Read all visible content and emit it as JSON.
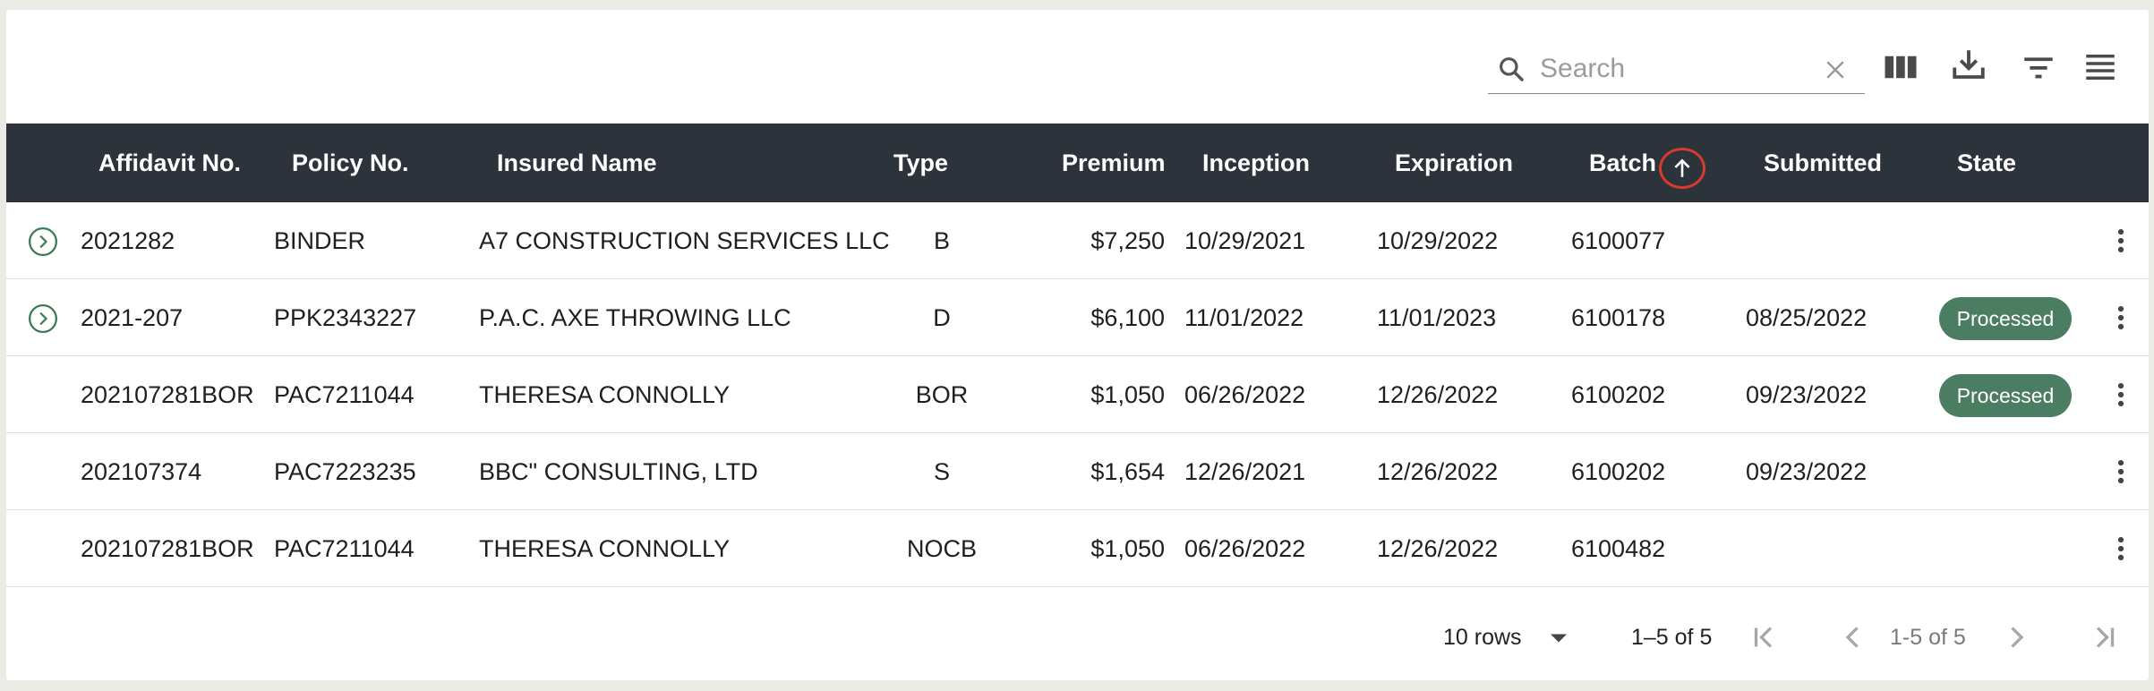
{
  "search": {
    "placeholder": "Search",
    "value": ""
  },
  "toolbar": {
    "icons": [
      "search-icon",
      "clear-icon",
      "columns-icon",
      "download-icon",
      "filter-icon",
      "density-icon"
    ]
  },
  "columns": {
    "affidavit": "Affidavit No.",
    "policy": "Policy No.",
    "insured": "Insured Name",
    "type": "Type",
    "premium": "Premium",
    "inception": "Inception",
    "expiration": "Expiration",
    "batch": "Batch",
    "submitted": "Submitted",
    "state": "State"
  },
  "sort": {
    "column": "Batch",
    "direction": "ascending",
    "icon": "arrow-up-icon",
    "highlight_color": "#d83a2e"
  },
  "rows": [
    {
      "expandable": true,
      "affidavit": "2021282",
      "policy": "BINDER",
      "insured": "A7 CONSTRUCTION SERVICES LLC",
      "type": "B",
      "premium": "$7,250",
      "inception": "10/29/2021",
      "expiration": "10/29/2022",
      "batch": "6100077",
      "submitted": "",
      "state": ""
    },
    {
      "expandable": true,
      "affidavit": "2021-207",
      "policy": "PPK2343227",
      "insured": "P.A.C. AXE THROWING LLC",
      "type": "D",
      "premium": "$6,100",
      "inception": "11/01/2022",
      "expiration": "11/01/2023",
      "batch": "6100178",
      "submitted": "08/25/2022",
      "state": "Processed"
    },
    {
      "expandable": false,
      "affidavit": "202107281BOR",
      "policy": "PAC7211044",
      "insured": "THERESA CONNOLLY",
      "type": "BOR",
      "premium": "$1,050",
      "inception": "06/26/2022",
      "expiration": "12/26/2022",
      "batch": "6100202",
      "submitted": "09/23/2022",
      "state": "Processed"
    },
    {
      "expandable": false,
      "affidavit": "202107374",
      "policy": "PAC7223235",
      "insured": "BBC\" CONSULTING, LTD",
      "type": "S",
      "premium": "$1,654",
      "inception": "12/26/2021",
      "expiration": "12/26/2022",
      "batch": "6100202",
      "submitted": "09/23/2022",
      "state": ""
    },
    {
      "expandable": false,
      "affidavit": "202107281BOR",
      "policy": "PAC7211044",
      "insured": "THERESA CONNOLLY",
      "type": "NOCB",
      "premium": "$1,050",
      "inception": "06/26/2022",
      "expiration": "12/26/2022",
      "batch": "6100482",
      "submitted": "",
      "state": ""
    }
  ],
  "pagination": {
    "rows_per_page": "10 rows",
    "range": "1–5 of 5",
    "page_info": "1-5 of 5"
  },
  "colors": {
    "header_bg": "#2d333b",
    "badge_bg": "#4b7d62",
    "expand_icon": "#3f7a5a"
  }
}
